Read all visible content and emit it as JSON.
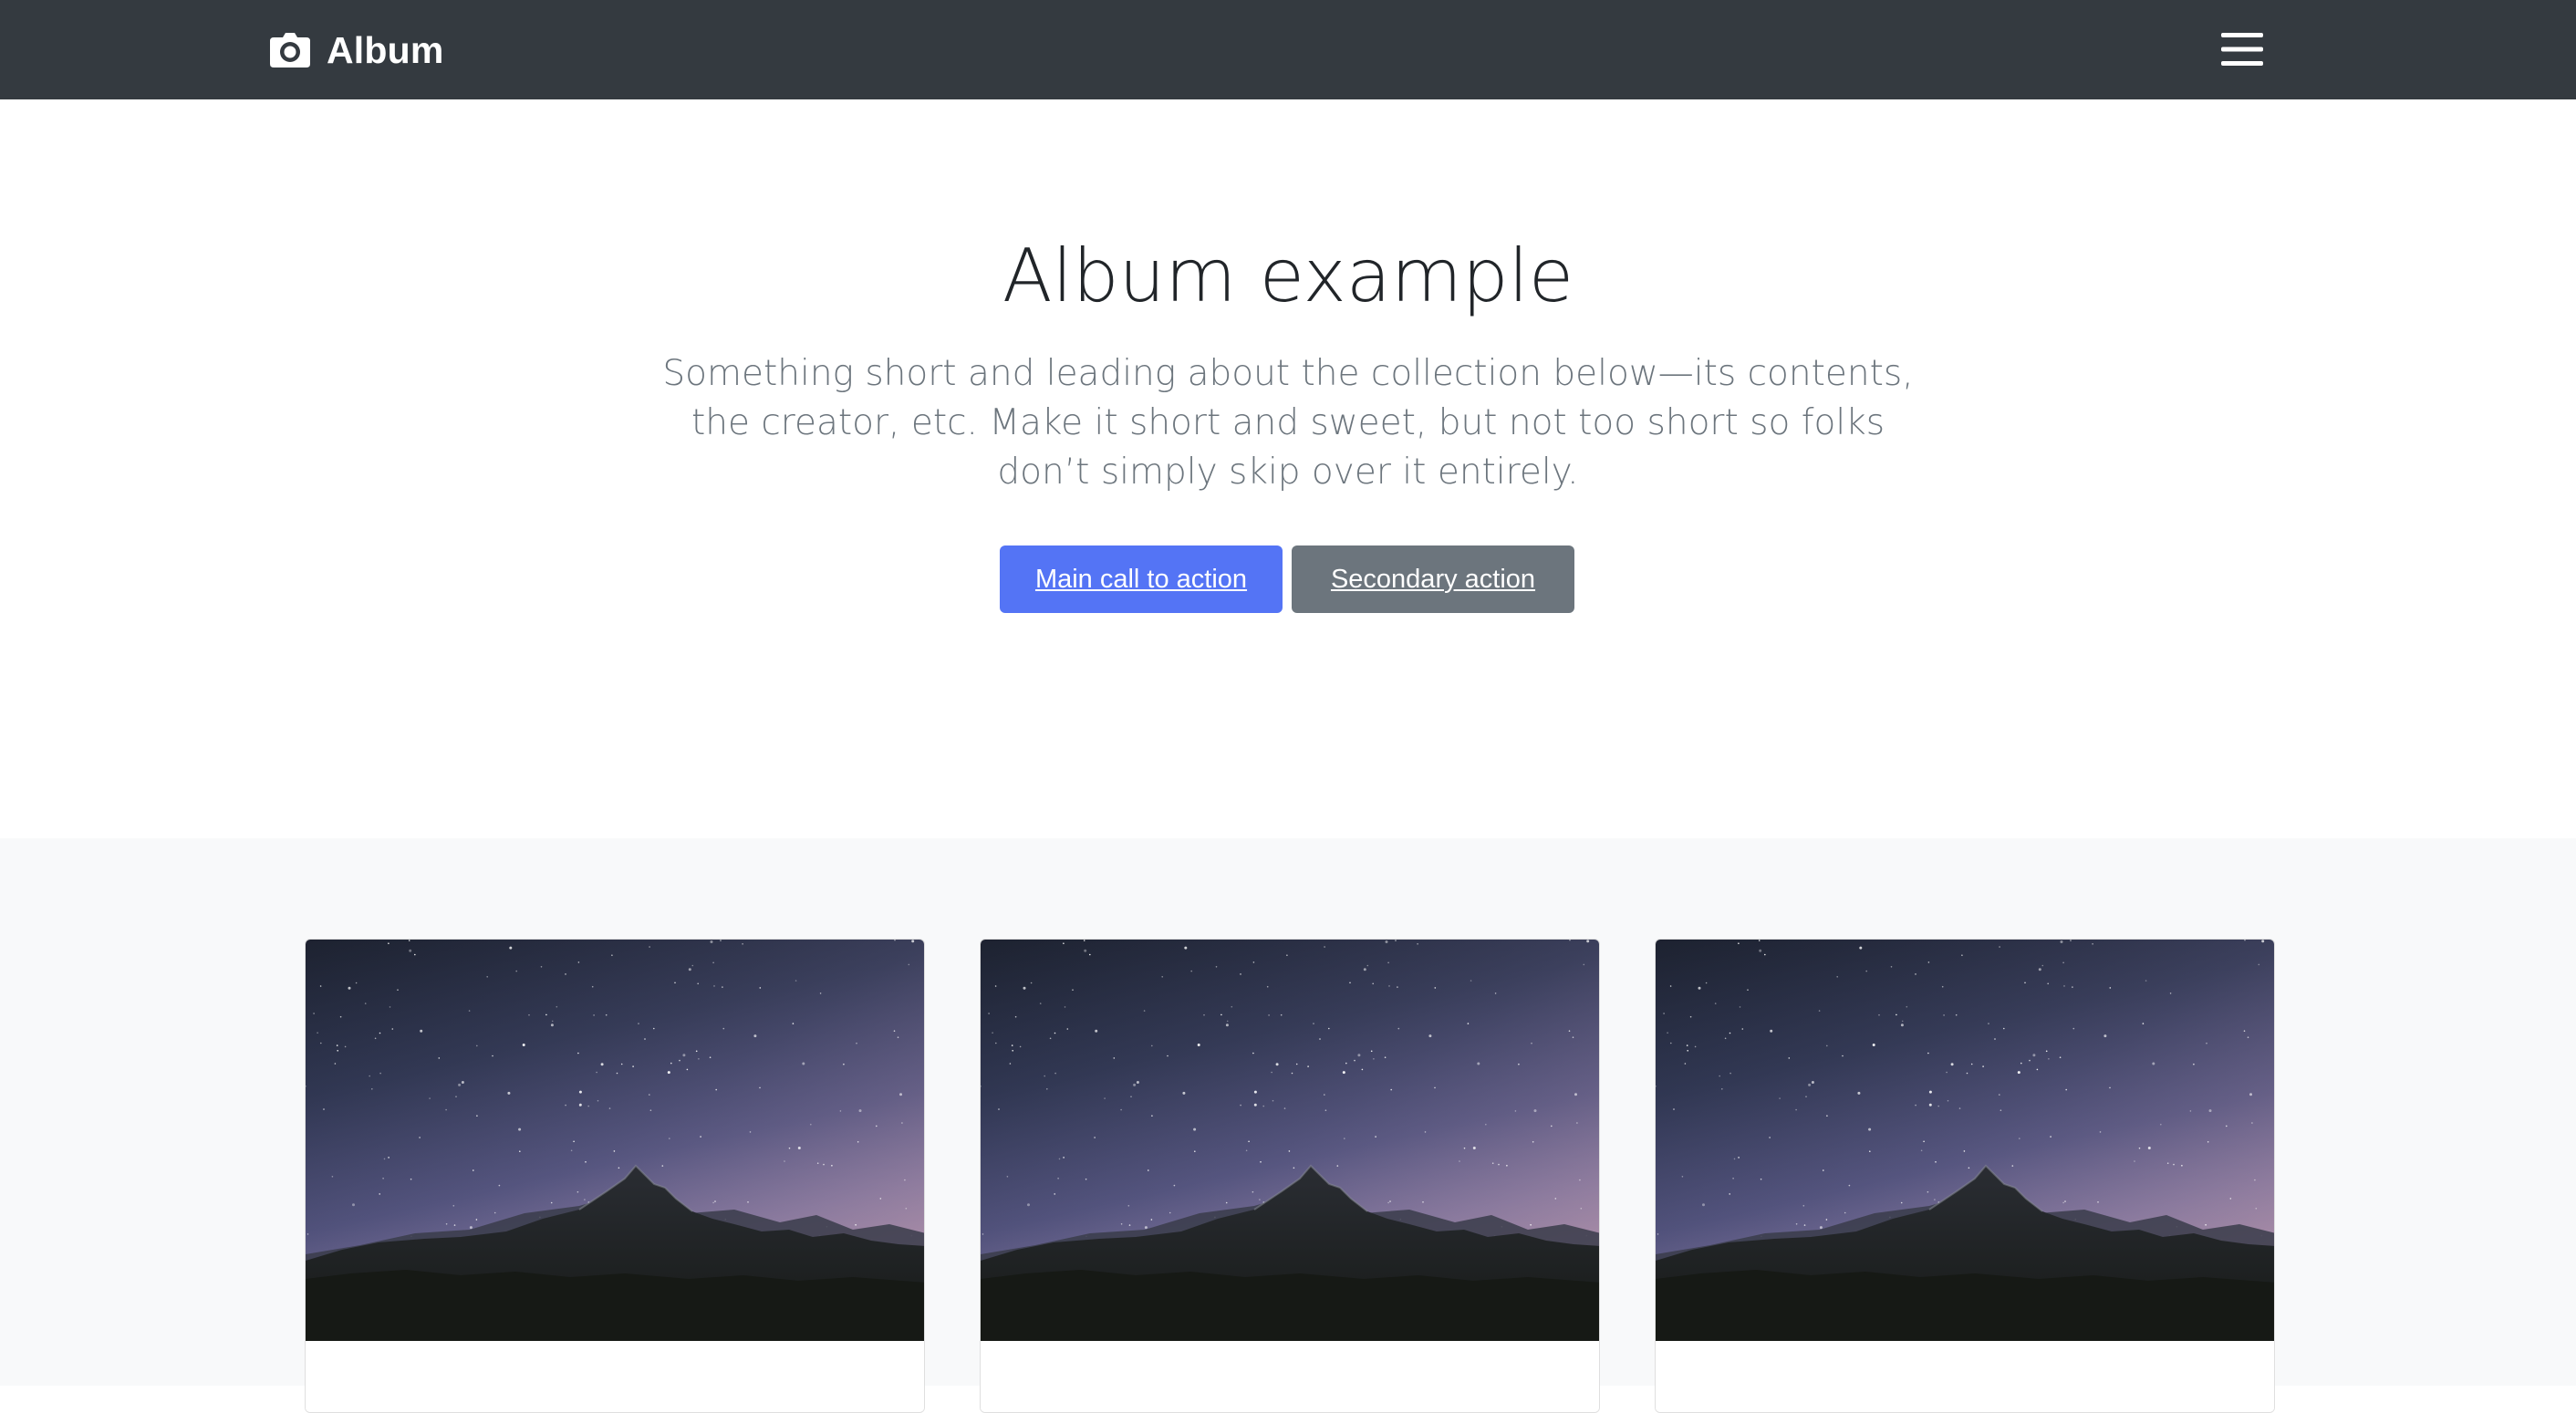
{
  "navbar": {
    "brand": "Album",
    "brand_icon": "camera-icon",
    "toggler_icon": "hamburger-menu-icon",
    "background": "#343a40"
  },
  "hero": {
    "title": "Album example",
    "lead": "Something short and leading about the collection below—its contents, the creator, etc. Make it short and sweet, but not too short so folks don’t simply skip over it entirely.",
    "primary_button": "Main call to action",
    "secondary_button": "Secondary action"
  },
  "album": {
    "background": "#f8f9fa",
    "cards": [
      {
        "image": "starry-mountain-night-sky"
      },
      {
        "image": "starry-mountain-night-sky"
      },
      {
        "image": "starry-mountain-night-sky"
      }
    ]
  },
  "colors": {
    "primary": "#5474f5",
    "secondary": "#6c757d",
    "text": "#212529",
    "muted": "#6c757d"
  }
}
